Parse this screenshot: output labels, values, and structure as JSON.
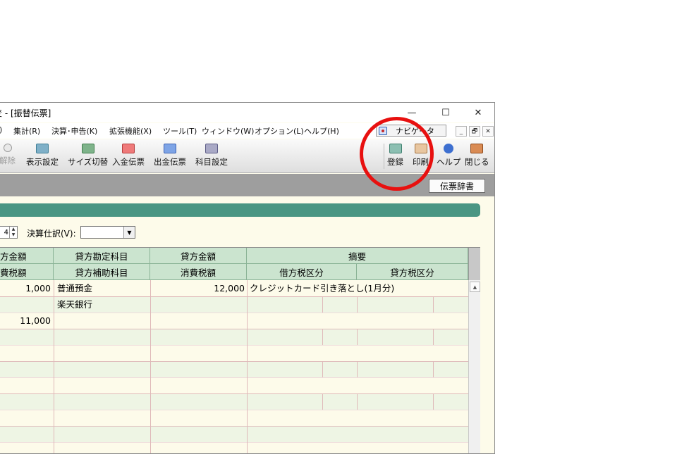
{
  "window": {
    "title": "変 - [振替伝票]",
    "minimize_glyph": "—",
    "maximize_glyph": "☐",
    "close_glyph": "✕"
  },
  "menu": {
    "items": [
      {
        "label": ")"
      },
      {
        "label": "集計(R)"
      },
      {
        "label": "決算･申告(K)"
      },
      {
        "label": "拡張機能(X)"
      },
      {
        "label": "ツール(T)"
      },
      {
        "label": "ウィンドウ(W)"
      },
      {
        "label": "オプション(L)"
      },
      {
        "label": "ヘルプ(H)"
      }
    ],
    "navigator_label": "ナビゲータ",
    "mdi_minimize": "_",
    "mdi_restore": "🗗",
    "mdi_close": "✕"
  },
  "toolbar": {
    "tools": [
      {
        "label": "解除",
        "icon": "search-icon"
      },
      {
        "label": "表示設定",
        "icon": "display-settings-icon"
      },
      {
        "label": "サイズ切替",
        "icon": "size-toggle-icon"
      },
      {
        "label": "入金伝票",
        "icon": "receipt-slip-icon"
      },
      {
        "label": "出金伝票",
        "icon": "payment-slip-icon"
      },
      {
        "label": "科目設定",
        "icon": "account-settings-icon"
      },
      {
        "label": "登録",
        "icon": "register-icon"
      },
      {
        "label": "印刷",
        "icon": "print-icon"
      },
      {
        "label": "ヘルプ",
        "icon": "help-icon"
      },
      {
        "label": "閉じる",
        "icon": "close-door-icon"
      }
    ]
  },
  "subbar": {
    "dictionary_button": "伝票辞書"
  },
  "options": {
    "spin_value": "4",
    "closing_entry_label": "決算仕訳(V):",
    "closing_entry_value": ""
  },
  "grid": {
    "header_row1": [
      "方金額",
      "貸方勘定科目",
      "貸方金額",
      "摘要"
    ],
    "header_row2": [
      "費税額",
      "貸方補助科目",
      "消費税額",
      "借方税区分",
      "貸方税区分"
    ],
    "rows": [
      {
        "debit_amount": "1,000",
        "credit_account": "普通預金",
        "credit_amount": "12,000",
        "description": "クレジットカード引き落とし(1月分)"
      },
      {
        "debit_amount": "",
        "credit_account": "楽天銀行",
        "credit_amount": "",
        "description": ""
      },
      {
        "debit_amount": "11,000",
        "credit_account": "",
        "credit_amount": "",
        "description": ""
      }
    ]
  },
  "colors": {
    "header_green": "#cbe4cf",
    "band_teal": "#4a9683",
    "annotation_red": "#e8100f"
  }
}
